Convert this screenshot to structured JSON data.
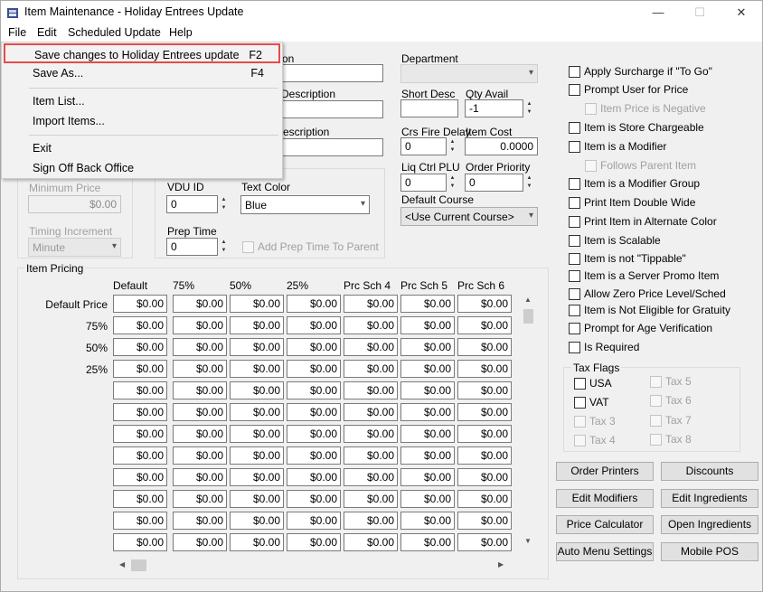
{
  "window": {
    "title": "Item Maintenance - Holiday Entrees Update",
    "minimize": "—",
    "maximize": "☐",
    "close": "✕"
  },
  "menubar": [
    "File",
    "Edit",
    "Scheduled Update",
    "Help"
  ],
  "file_menu": {
    "items": [
      {
        "label": "Save changes to Holiday Entrees update",
        "shortcut": "F2"
      },
      {
        "label": "Save As...",
        "shortcut": "F4"
      },
      {
        "label": "Item List...",
        "shortcut": ""
      },
      {
        "label": "Import Items...",
        "shortcut": ""
      },
      {
        "label": "Exit",
        "shortcut": ""
      },
      {
        "label": "Sign Off Back Office",
        "shortcut": ""
      }
    ]
  },
  "fields": {
    "name_partial": "on",
    "desc1_partial": "Description",
    "desc2_partial": "escription",
    "department_label": "Department",
    "department_value": "",
    "short_desc_label": "Short Desc",
    "short_desc_value": "",
    "qty_avail_label": "Qty Avail",
    "qty_avail_value": "-1",
    "crs_fire_delay_label": "Crs Fire Delay",
    "crs_fire_delay_value": "0",
    "item_cost_label": "Item Cost",
    "item_cost_value": "0.0000",
    "liq_ctrl_plu_label": "Liq Ctrl PLU",
    "liq_ctrl_plu_value": "0",
    "order_priority_label": "Order Priority",
    "order_priority_value": "0",
    "default_course_label": "Default Course",
    "default_course_value": "<Use Current Course>",
    "minimum_price_label": "Minimum Price",
    "minimum_price_value": "$0.00",
    "timing_increment_label": "Timing Increment",
    "timing_increment_value": "Minute",
    "vdu_id_label": "VDU ID",
    "vdu_id_value": "0",
    "text_color_label": "Text Color",
    "text_color_value": "Blue",
    "prep_time_label": "Prep Time",
    "prep_time_value": "0",
    "add_prep_time_label": "Add Prep Time To Parent"
  },
  "checkboxes": [
    {
      "label": "Apply Surcharge if \"To Go\"",
      "enabled": true
    },
    {
      "label": "Prompt User for Price",
      "enabled": true
    },
    {
      "label": "Item Price is Negative",
      "enabled": false
    },
    {
      "label": "Item is Store Chargeable",
      "enabled": true
    },
    {
      "label": "Item is a Modifier",
      "enabled": true
    },
    {
      "label": "Follows Parent Item",
      "enabled": false
    },
    {
      "label": "Item is a Modifier Group",
      "enabled": true
    },
    {
      "label": "Print Item Double Wide",
      "enabled": true
    },
    {
      "label": "Print Item in Alternate Color",
      "enabled": true
    },
    {
      "label": "Item is Scalable",
      "enabled": true
    },
    {
      "label": "Item is not \"Tippable\"",
      "enabled": true
    },
    {
      "label": "Item is a Server Promo Item",
      "enabled": true
    },
    {
      "label": "Allow Zero Price Level/Sched",
      "enabled": true
    },
    {
      "label": "Item is Not Eligible for Gratuity",
      "enabled": true
    },
    {
      "label": "Prompt for Age Verification",
      "enabled": true
    },
    {
      "label": "Is Required",
      "enabled": true
    }
  ],
  "tax_flags": {
    "title": "Tax Flags",
    "items": [
      {
        "label": "USA",
        "enabled": true
      },
      {
        "label": "VAT",
        "enabled": true
      },
      {
        "label": "Tax 3",
        "enabled": false
      },
      {
        "label": "Tax 4",
        "enabled": false
      },
      {
        "label": "Tax 5",
        "enabled": false
      },
      {
        "label": "Tax 6",
        "enabled": false
      },
      {
        "label": "Tax 7",
        "enabled": false
      },
      {
        "label": "Tax 8",
        "enabled": false
      }
    ]
  },
  "buttons": [
    "Order Printers",
    "Discounts",
    "Edit Modifiers",
    "Edit Ingredients",
    "Price Calculator",
    "Open Ingredients",
    "Auto Menu Settings",
    "Mobile POS"
  ],
  "pricing": {
    "title": "Item Pricing",
    "columns": [
      "Default",
      "75%",
      "50%",
      "25%",
      "Prc Sch 4",
      "Prc Sch 5",
      "Prc Sch 6"
    ],
    "row_labels": [
      "Default Price",
      "75%",
      "50%",
      "25%",
      "",
      "",
      "",
      "",
      "",
      "",
      "",
      ""
    ],
    "cell_value": "$0.00"
  },
  "icons": {
    "scroll_up": "▲",
    "scroll_down": "▼",
    "scroll_left": "◀",
    "scroll_right": "▶",
    "dropdown": "▾"
  }
}
